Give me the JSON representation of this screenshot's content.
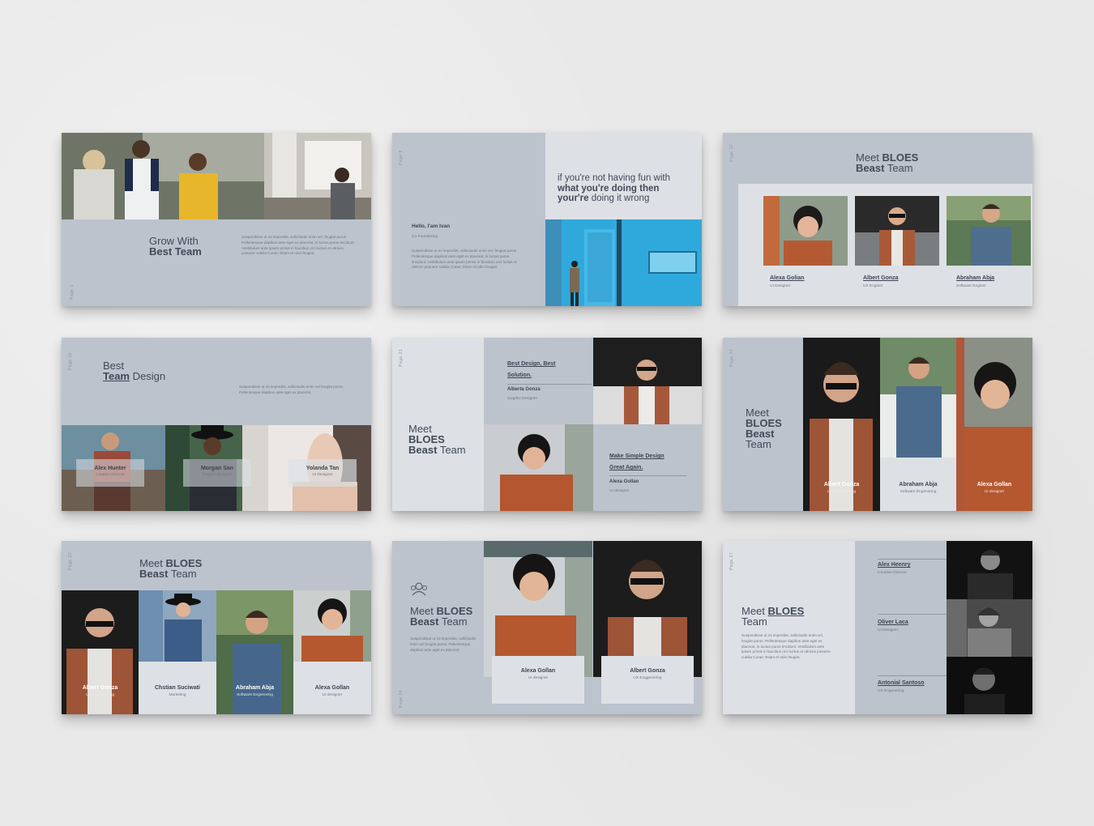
{
  "lorem": "Suspendisse ut mi imperdiet, sollicitudin enim vel, feugiat purus. Pellentesque dapibus ante eget ex placerat, in luctus purus tincidunt. Vestibulum ante ipsum primis in faucibus orci luctus et ultrices posuere cubilia Curae; Etiam et odio feugiat.",
  "lorem_short": "Suspendisse ut mi imperdiet, sollicitudin enim vel feugiat purus. Pellentesque dapibus ante eget ex placerat.",
  "slide1": {
    "title_line1": "Grow With",
    "title_line2": "Best Team",
    "page": "Page 1"
  },
  "slide2": {
    "quote_line1": "if you're not having fun with",
    "quote_line2": "what you're doing then",
    "quote_line3a": "your're",
    "quote_line3b": "doing it wrong",
    "hello": "Hello, I'am Ivan",
    "role": "Co-Foundering",
    "page": "Page 8"
  },
  "slide3": {
    "title_a": "Meet",
    "title_b": "BLOES",
    "title_c": "Beast",
    "title_d": "Team",
    "page": "Page 12",
    "people": [
      {
        "name": "Alexa Golian",
        "role": "UI Designer"
      },
      {
        "name": "Albert Gonza",
        "role": "UX Enginer"
      },
      {
        "name": "Abraham Abja",
        "role": "Software Enginer"
      }
    ]
  },
  "slide4": {
    "title_line1": "Best",
    "title_b": "Team",
    "title_c": "Design",
    "page": "Page 16",
    "people": [
      {
        "name": "Alex Hunter",
        "role": "Creative Director"
      },
      {
        "name": "Morgan San",
        "role": "Graphic Designer"
      },
      {
        "name": "Yolanda Tan",
        "role": "UI Designer"
      }
    ]
  },
  "slide5": {
    "title_a": "Meet",
    "title_b": "BLOES",
    "title_c": "Beast",
    "title_d": "Team",
    "page": "Page 21",
    "block1_line1": "Best Design, Best",
    "block1_line2": "Solution.",
    "block1_name": "Alberta Gonza",
    "block1_role": "Graphic Designer",
    "block2_line1": "Make Simple Design",
    "block2_line2": "Great Again.",
    "block2_name": "Alexa Gollan",
    "block2_role": "UI designer"
  },
  "slide6": {
    "title_a": "Meet",
    "title_b": "BLOES",
    "title_c": "Beast",
    "title_d": "Team",
    "page": "Page 22",
    "people": [
      {
        "name": "Albert Gonza",
        "role": "UX Enggenering"
      },
      {
        "name": "Abraham Abja",
        "role": "Software Engenering"
      },
      {
        "name": "Alexa Gollan",
        "role": "UI designer"
      }
    ]
  },
  "slide7": {
    "title_a": "Meet",
    "title_b": "BLOES",
    "title_c": "Beast",
    "title_d": "Team",
    "page": "Page 23",
    "people": [
      {
        "name": "Albert Gonza",
        "role": "UX Enggenering"
      },
      {
        "name": "Chstian Suciwati",
        "role": "Marketing"
      },
      {
        "name": "Abraham Abja",
        "role": "Software Engenering"
      },
      {
        "name": "Alexa Gollan",
        "role": "UI designer"
      }
    ]
  },
  "slide8": {
    "title_a": "Meet",
    "title_b": "BLOES",
    "title_c": "Beast",
    "title_d": "Team",
    "page": "Page 24",
    "people": [
      {
        "name": "Alexa Gollan",
        "role": "UI designer"
      },
      {
        "name": "Albert Gonza",
        "role": "UX Enggenering"
      }
    ]
  },
  "slide9": {
    "title_a": "Meet",
    "title_b": "BLOES",
    "title_c": "Team",
    "page": "Page 27",
    "people": [
      {
        "name": "Alex Heenry",
        "role": "Creative Director"
      },
      {
        "name": "Oliver Laca",
        "role": "UI Designer"
      },
      {
        "name": "Antonial Santoso",
        "role": "UX Engenering"
      }
    ]
  }
}
